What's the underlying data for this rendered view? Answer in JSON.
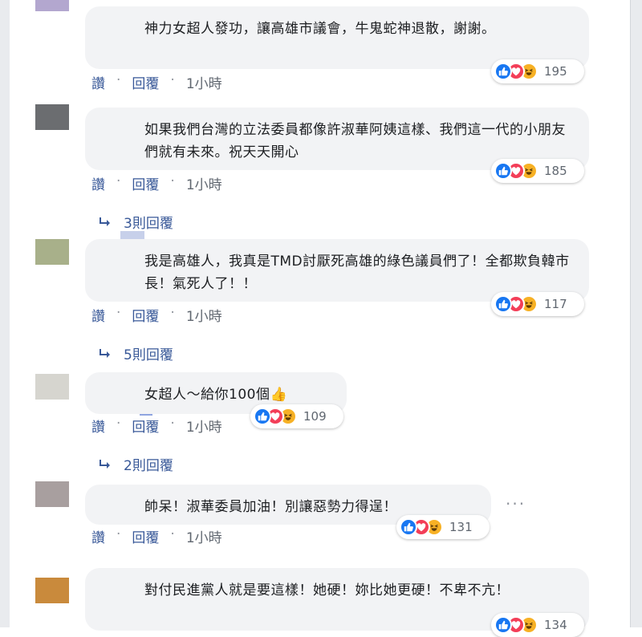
{
  "actions": {
    "like": "讚",
    "sep": "·",
    "reply": "回覆"
  },
  "comments": [
    {
      "text": "神力女超人發功，讓高雄市議會，牛鬼蛇神退散，謝謝。",
      "count": "195",
      "time": "1小時",
      "avatar_color": "#b3a7cf"
    },
    {
      "text": "如果我們台灣的立法委員都像許淑華阿姨這樣、我們這一代的小朋友們就有未來。祝天天開心",
      "count": "185",
      "time": "1小時",
      "avatar_color": "#6b6d70",
      "replies": "3則回覆"
    },
    {
      "text": "我是高雄人，我真是TMD討厭死高雄的綠色議員們了！全都欺負韓市長！氣死人了！！",
      "count": "117",
      "time": "1小時",
      "avatar_color": "#a8b08a",
      "replies": "5則回覆"
    },
    {
      "text": "女超人～給你100個👍",
      "count": "109",
      "time": "1小時",
      "avatar_color": "#d6d5cf",
      "replies": "2則回覆"
    },
    {
      "text": "帥呆！淑華委員加油！別讓惡勢力得逞！",
      "count": "131",
      "time": "1小時",
      "avatar_color": "#a89f9f"
    },
    {
      "text": "對付民進黨人就是要這樣！她硬！妳比她更硬！不卑不亢！",
      "count": "134",
      "avatar_color": "#c98a3c"
    }
  ],
  "colors": {
    "like": "#1877f2",
    "love": "#f33e58",
    "haha": "#f7b125",
    "link": "#385898"
  },
  "icons": {
    "like": "thumbs-up-icon",
    "love": "heart-icon",
    "haha": "laughing-face-icon",
    "reply_arrow": "reply-arrow-icon",
    "more": "more-options-icon"
  }
}
